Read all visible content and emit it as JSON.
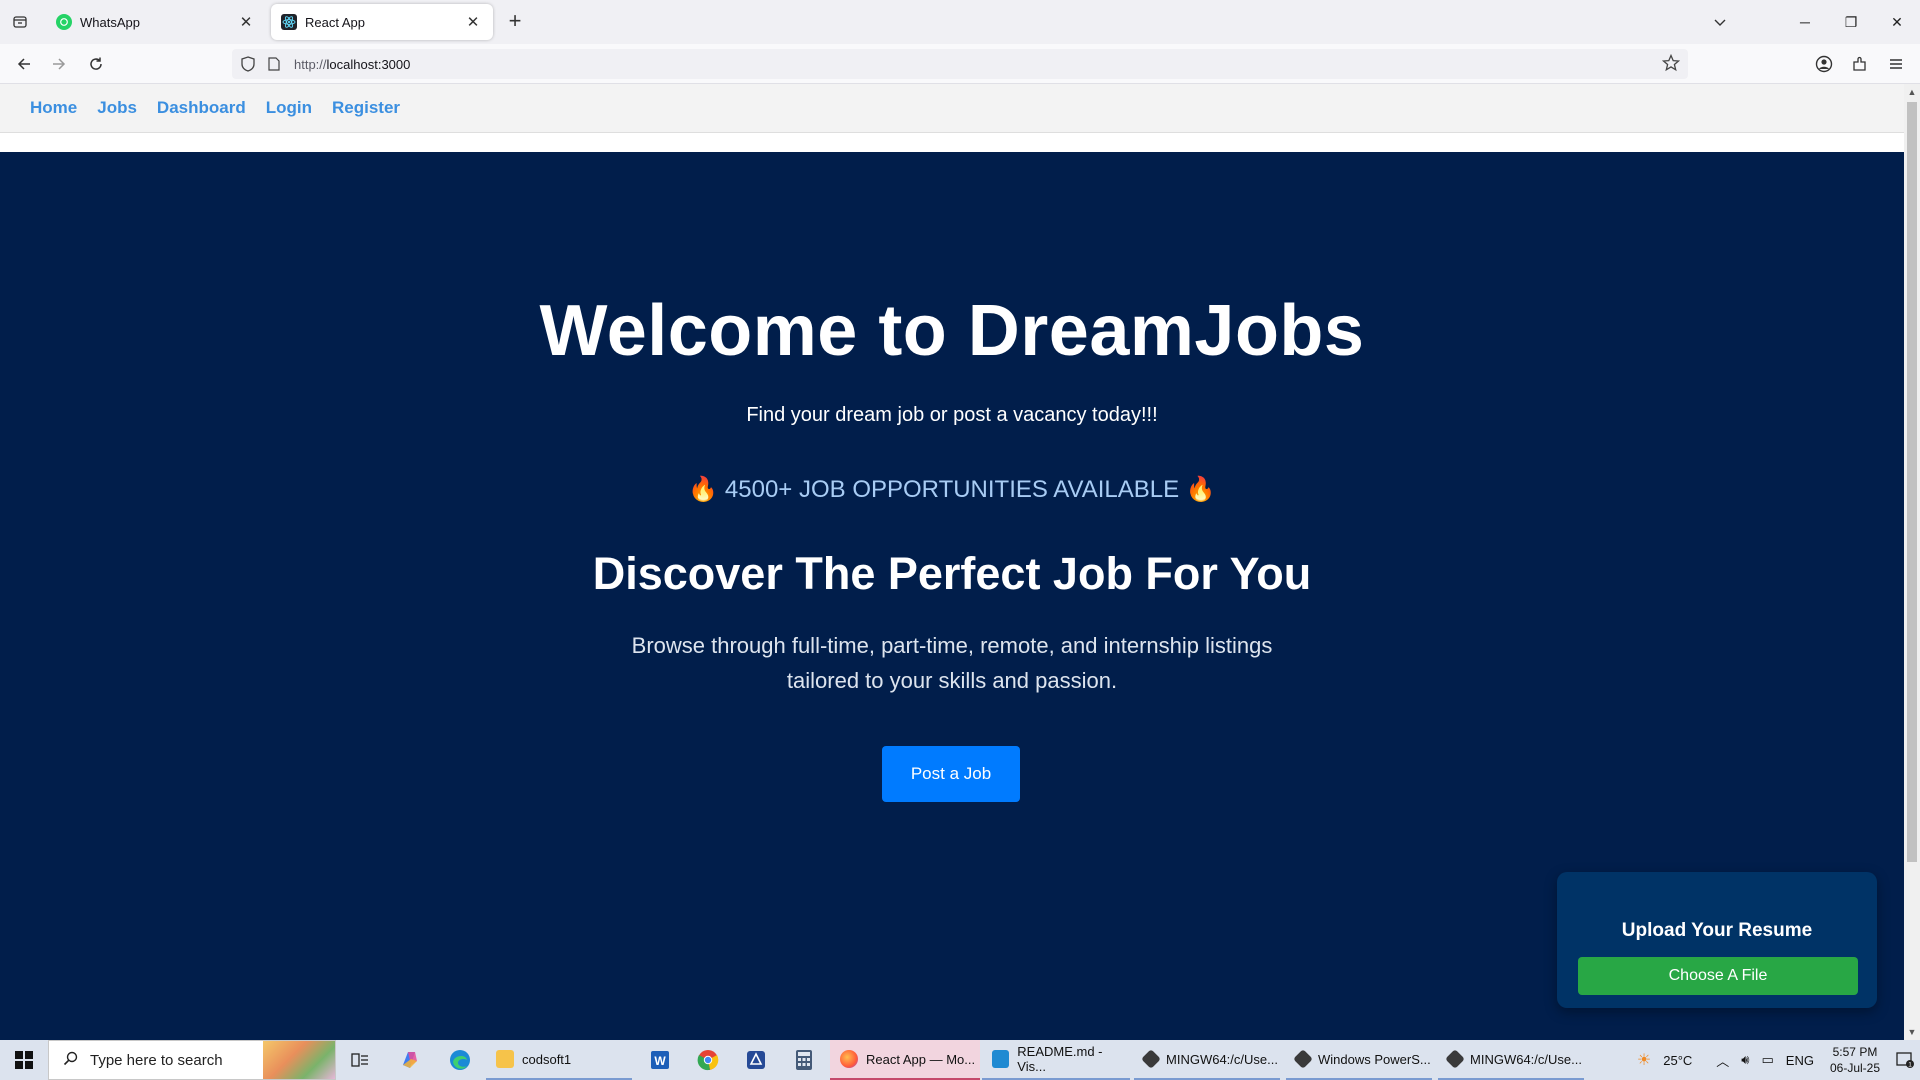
{
  "browser": {
    "tabs": [
      {
        "title": "WhatsApp",
        "icon": "whatsapp-icon",
        "active": false
      },
      {
        "title": "React App",
        "icon": "react-icon",
        "active": true
      }
    ],
    "url_prefix": "http://",
    "url_host": "localhost:3000"
  },
  "site": {
    "nav": [
      "Home",
      "Jobs",
      "Dashboard",
      "Login",
      "Register"
    ],
    "hero_title": "Welcome to DreamJobs",
    "hero_subtitle": "Find your dream job or post a vacancy today!!!",
    "opportunities": "🔥 4500+ JOB OPPORTUNITIES AVAILABLE 🔥",
    "headline": "Discover The Perfect Job For You",
    "description": "Browse through full-time, part-time, remote, and internship listings tailored to your skills and passion.",
    "post_button": "Post a Job",
    "resume_title": "Upload Your Resume",
    "resume_button": "Choose A File"
  },
  "taskbar": {
    "search_placeholder": "Type here to search",
    "apps": [
      {
        "label": "codsoft1",
        "icon": "folder-icon"
      },
      {
        "label": "React App — Mo...",
        "icon": "firefox-icon"
      },
      {
        "label": "README.md - Vis...",
        "icon": "vscode-icon"
      },
      {
        "label": "MINGW64:/c/Use...",
        "icon": "git-icon"
      },
      {
        "label": "Windows PowerS...",
        "icon": "powershell-icon"
      },
      {
        "label": "MINGW64:/c/Use...",
        "icon": "git-icon"
      }
    ],
    "weather": "25°C",
    "language": "ENG",
    "time": "5:57 PM",
    "date": "06-Jul-25",
    "notification_count": "1"
  },
  "colors": {
    "hero_bg": "#011e4b",
    "nav_link": "#3b8fe0",
    "post_button": "#007bff",
    "resume_card": "#003366",
    "choose_button": "#28a745"
  }
}
